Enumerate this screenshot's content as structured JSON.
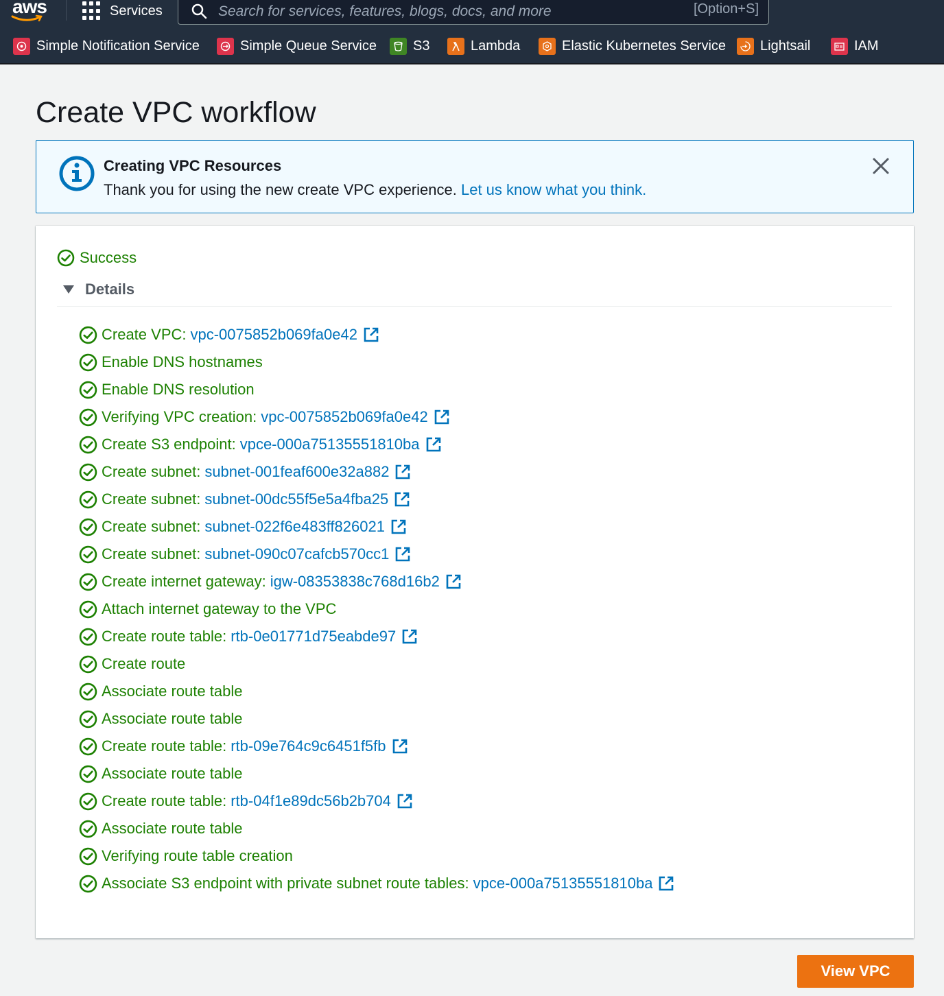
{
  "nav": {
    "logo_text": "aws",
    "services_label": "Services",
    "search_placeholder": "Search for services, features, blogs, docs, and more",
    "search_shortcut": "[Option+S]"
  },
  "favorites": [
    {
      "label": "Simple Notification Service",
      "color": "#dd344c",
      "icon": "sns-icon"
    },
    {
      "label": "Simple Queue Service",
      "color": "#dd344c",
      "icon": "sqs-icon"
    },
    {
      "label": "S3",
      "color": "#3f8624",
      "icon": "s3-icon"
    },
    {
      "label": "Lambda",
      "color": "#e7711b",
      "icon": "lambda-icon"
    },
    {
      "label": "Elastic Kubernetes Service",
      "color": "#e7711b",
      "icon": "eks-icon"
    },
    {
      "label": "Lightsail",
      "color": "#e7711b",
      "icon": "lightsail-icon"
    },
    {
      "label": "IAM",
      "color": "#dd344c",
      "icon": "iam-icon"
    }
  ],
  "page": {
    "title": "Create VPC workflow"
  },
  "flash": {
    "title": "Creating VPC Resources",
    "message": "Thank you for using the new create VPC experience.",
    "link_text": "Let us know what you think."
  },
  "status": {
    "label": "Success",
    "details_label": "Details"
  },
  "steps": [
    {
      "label": "Create VPC:",
      "resource": "vpc-0075852b069fa0e42"
    },
    {
      "label": "Enable DNS hostnames",
      "resource": ""
    },
    {
      "label": "Enable DNS resolution",
      "resource": ""
    },
    {
      "label": "Verifying VPC creation:",
      "resource": "vpc-0075852b069fa0e42"
    },
    {
      "label": "Create S3 endpoint:",
      "resource": "vpce-000a75135551810ba"
    },
    {
      "label": "Create subnet:",
      "resource": "subnet-001feaf600e32a882"
    },
    {
      "label": "Create subnet:",
      "resource": "subnet-00dc55f5e5a4fba25"
    },
    {
      "label": "Create subnet:",
      "resource": "subnet-022f6e483ff826021"
    },
    {
      "label": "Create subnet:",
      "resource": "subnet-090c07cafcb570cc1"
    },
    {
      "label": "Create internet gateway:",
      "resource": "igw-08353838c768d16b2"
    },
    {
      "label": "Attach internet gateway to the VPC",
      "resource": ""
    },
    {
      "label": "Create route table:",
      "resource": "rtb-0e01771d75eabde97"
    },
    {
      "label": "Create route",
      "resource": ""
    },
    {
      "label": "Associate route table",
      "resource": ""
    },
    {
      "label": "Associate route table",
      "resource": ""
    },
    {
      "label": "Create route table:",
      "resource": "rtb-09e764c9c6451f5fb"
    },
    {
      "label": "Associate route table",
      "resource": ""
    },
    {
      "label": "Create route table:",
      "resource": "rtb-04f1e89dc56b2b704"
    },
    {
      "label": "Associate route table",
      "resource": ""
    },
    {
      "label": "Verifying route table creation",
      "resource": ""
    },
    {
      "label": "Associate S3 endpoint with private subnet route tables:",
      "resource": "vpce-000a75135551810ba"
    }
  ],
  "actions": {
    "view_vpc_label": "View VPC"
  },
  "colors": {
    "success": "#1d8102",
    "link": "#0073bb",
    "primary_button": "#ec7211",
    "nav_bg": "#232f3e",
    "info_bg": "#f1faff"
  }
}
